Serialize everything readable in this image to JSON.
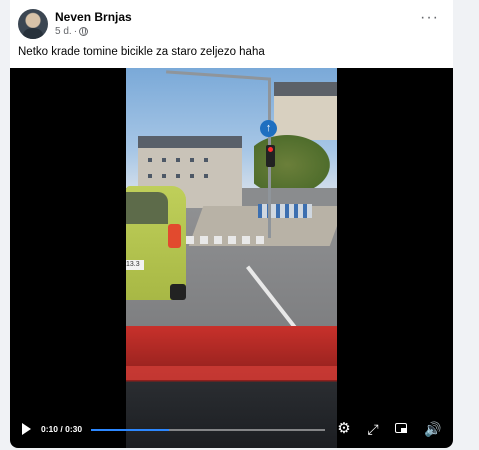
{
  "post": {
    "author": "Neven Brnjas",
    "age": "5 d.",
    "separator": "·",
    "caption": "Netko krade tomine bicikle za staro zeljezo haha",
    "more_label": "···"
  },
  "video": {
    "time_display": "0:10 / 0:30",
    "current_seconds": 10,
    "total_seconds": 30,
    "progress": 0.333,
    "plate_text": "13.3",
    "sign_glyph": "↑"
  },
  "icons": {
    "play": "play-icon",
    "settings": "gear-icon",
    "fullscreen": "expand-icon",
    "miniplayer": "miniplayer-icon",
    "volume": "volume-icon"
  },
  "colors": {
    "accent": "#2d88ff",
    "background": "#f0f2f5",
    "card": "#ffffff"
  }
}
